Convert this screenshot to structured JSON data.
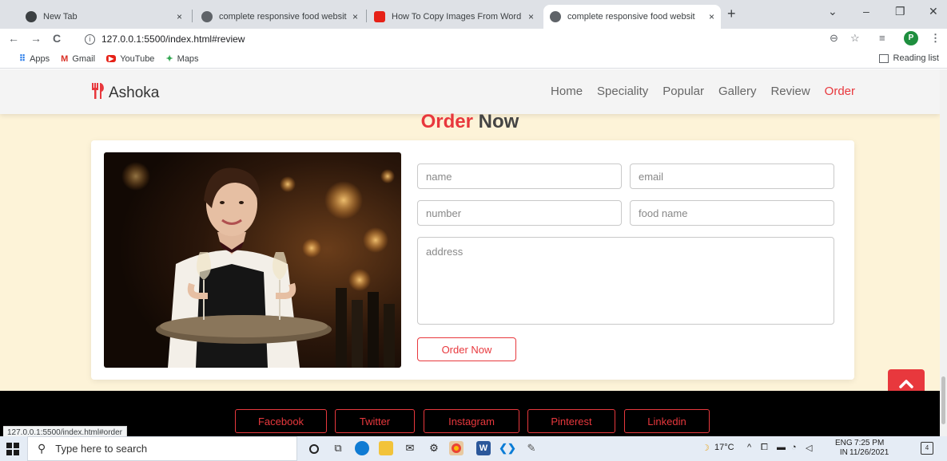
{
  "browser": {
    "tabs": [
      {
        "title": "New Tab",
        "close": "×"
      },
      {
        "title": "complete responsive food websit",
        "close": "×"
      },
      {
        "title": "How To Copy Images From Word",
        "close": "×"
      },
      {
        "title": "complete responsive food websit",
        "close": "×"
      }
    ],
    "new_tab": "+",
    "window_controls": {
      "chevron": "⌄",
      "minimize": "–",
      "restore": "❐",
      "close": "✕"
    },
    "nav": {
      "back": "←",
      "forward": "→",
      "reload": "C"
    },
    "url": "127.0.0.1:5500/index.html#review",
    "url_info_icon": "i",
    "profile_initial": "P",
    "toolbar_icons": {
      "zoom": "⊖",
      "star": "☆",
      "playlist": "≡",
      "menu": "⋮"
    },
    "bookmarks": [
      {
        "label": "Apps",
        "icon": "⠿"
      },
      {
        "label": "Gmail",
        "icon": "M"
      },
      {
        "label": "YouTube",
        "icon": "▶"
      },
      {
        "label": "Maps",
        "icon": "✦"
      }
    ],
    "reading_list": "Reading list",
    "status_url": "127.0.0.1:5500/index.html#order"
  },
  "site": {
    "logo": "Ashoka",
    "logo_icon": "🍴",
    "nav": [
      "Home",
      "Speciality",
      "Popular",
      "Gallery",
      "Review",
      "Order"
    ],
    "active_nav": "Order",
    "section_title_accent": "Order",
    "section_title_rest": "Now",
    "form": {
      "name_placeholder": "name",
      "email_placeholder": "email",
      "number_placeholder": "number",
      "food_placeholder": "food name",
      "address_placeholder": "address",
      "submit_label": "Order Now"
    },
    "social": [
      "Facebook",
      "Twitter",
      "Instagram",
      "Pinterest",
      "Linkedin"
    ],
    "accent_color": "#e8383d",
    "section_bg": "#fdf3d8"
  },
  "taskbar": {
    "search_placeholder": "Type here to search",
    "weather": "17°C",
    "lang_top": "ENG",
    "lang_bottom": "IN",
    "time": "7:25 PM",
    "date": "11/26/2021",
    "notifications": "4"
  }
}
